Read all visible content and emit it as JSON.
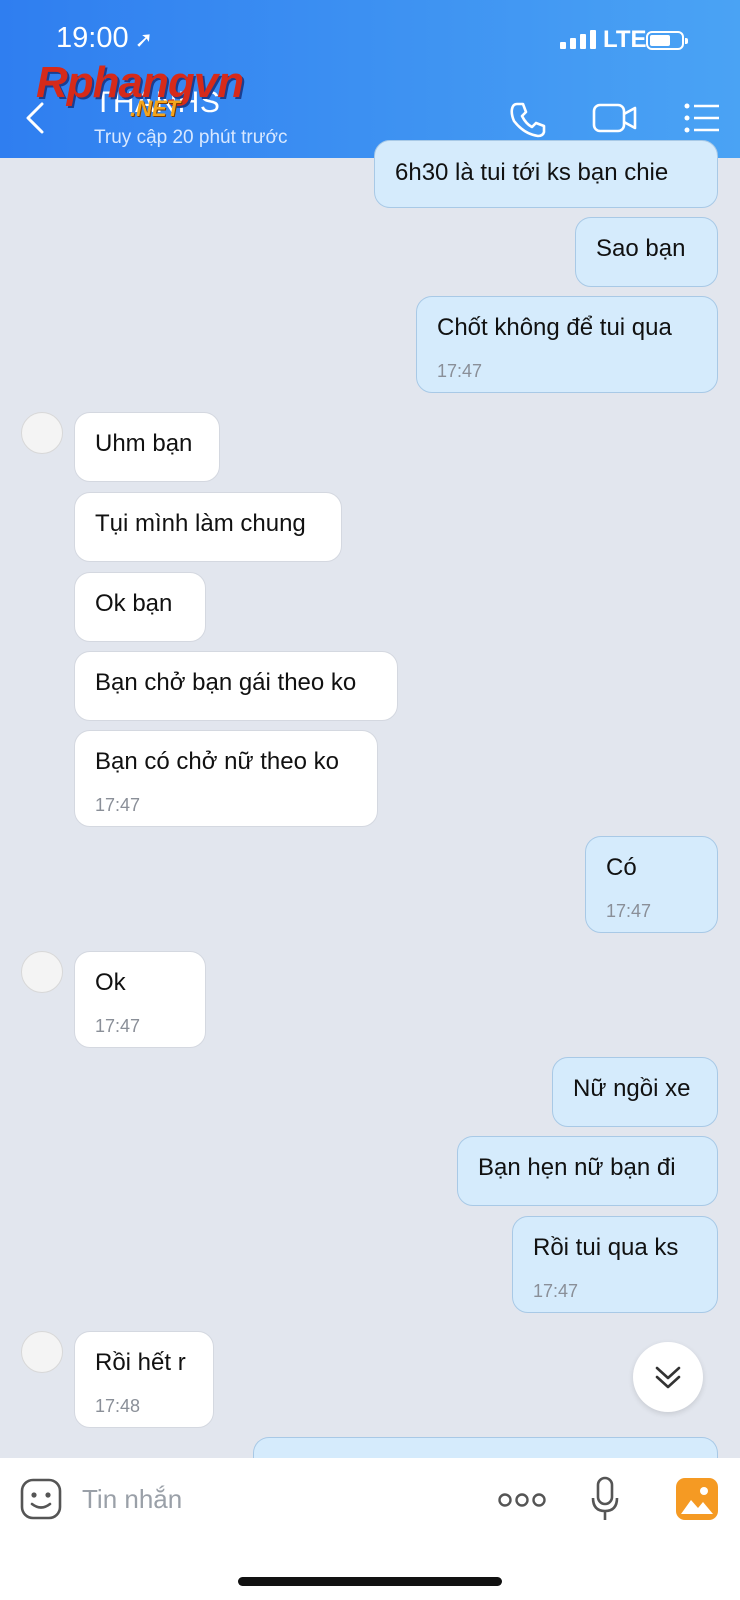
{
  "status_bar": {
    "time": "19:00",
    "network": "LTE"
  },
  "header": {
    "title": "THANHS",
    "subtitle": "Truy cập 20 phút trước",
    "watermark": "Rphangvn",
    "watermark_suffix": ".NET"
  },
  "messages": [
    {
      "side": "me",
      "text": "6h30 là tui tới ks bạn chie",
      "time": ""
    },
    {
      "side": "me",
      "text": "Sao bạn",
      "time": ""
    },
    {
      "side": "me",
      "text": "Chốt không để tui qua",
      "time": "17:47"
    },
    {
      "side": "them",
      "text": "Uhm bạn",
      "time": ""
    },
    {
      "side": "them",
      "text": "Tụi mình làm chung",
      "time": ""
    },
    {
      "side": "them",
      "text": "Ok bạn",
      "time": ""
    },
    {
      "side": "them",
      "text": "Bạn chở bạn gái theo ko",
      "time": ""
    },
    {
      "side": "them",
      "text": "Bạn có chở nữ theo ko",
      "time": "17:47"
    },
    {
      "side": "me",
      "text": "Có",
      "time": "17:47"
    },
    {
      "side": "them",
      "text": " Ok",
      "time": "17:47"
    },
    {
      "side": "me",
      "text": "Nữ ngồi xe",
      "time": ""
    },
    {
      "side": "me",
      "text": "Bạn hẹn nữ bạn đi",
      "time": ""
    },
    {
      "side": "me",
      "text": "Rồi tui qua ks",
      "time": "17:47"
    },
    {
      "side": "them",
      "text": "Rồi hết r",
      "time": "17:48"
    }
  ],
  "input": {
    "placeholder": "Tin nhắn"
  },
  "icons": {
    "back": "chevron-left-icon",
    "call": "phone-icon",
    "video": "video-camera-icon",
    "menu": "list-menu-icon",
    "sticker": "sticker-icon",
    "more": "more-dots-icon",
    "mic": "microphone-icon",
    "gallery": "image-gallery-icon",
    "scroll": "double-chevron-down-icon"
  },
  "colors": {
    "header_start": "#2f7ef0",
    "header_end": "#4aa3f4",
    "bubble_me": "#d5ebfc",
    "bubble_them": "#ffffff",
    "background": "#e2e6ee",
    "gallery_icon": "#f59a23"
  }
}
